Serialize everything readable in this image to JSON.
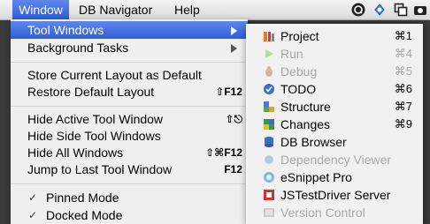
{
  "menubar": {
    "items": [
      {
        "label": "Window"
      },
      {
        "label": "DB Navigator"
      },
      {
        "label": "Help"
      }
    ],
    "tray_icons": [
      "help-circle-icon",
      "sync-icon",
      "window-switch-icon",
      "camera-icon"
    ]
  },
  "window_menu": {
    "items": [
      {
        "label": "Tool Windows",
        "has_submenu": true
      },
      {
        "label": "Background Tasks",
        "has_submenu": true
      },
      {
        "label": "Store Current Layout as Default"
      },
      {
        "label": "Restore Default Layout",
        "shortcut": "⇧F12"
      },
      {
        "label": "Hide Active Tool Window",
        "shortcut": "⇧⎋"
      },
      {
        "label": "Hide Side Tool Windows"
      },
      {
        "label": "Hide All Windows",
        "shortcut": "⇧⌘F12"
      },
      {
        "label": "Jump to Last Tool Window",
        "shortcut": "F12"
      },
      {
        "label": "Pinned Mode",
        "checked": true
      },
      {
        "label": "Docked Mode",
        "checked": true
      }
    ],
    "check_glyph": "✓"
  },
  "tool_windows_submenu": {
    "items": [
      {
        "label": "Project",
        "shortcut": "⌘1",
        "enabled": true,
        "icon": "project-icon"
      },
      {
        "label": "Run",
        "shortcut": "⌘4",
        "enabled": false,
        "icon": "run-icon"
      },
      {
        "label": "Debug",
        "shortcut": "⌘5",
        "enabled": false,
        "icon": "debug-icon"
      },
      {
        "label": "TODO",
        "shortcut": "⌘6",
        "enabled": true,
        "icon": "todo-icon"
      },
      {
        "label": "Structure",
        "shortcut": "⌘7",
        "enabled": true,
        "icon": "structure-icon"
      },
      {
        "label": "Changes",
        "shortcut": "⌘9",
        "enabled": true,
        "icon": "changes-icon"
      },
      {
        "label": "DB Browser",
        "enabled": true,
        "icon": "db-browser-icon"
      },
      {
        "label": "Dependency Viewer",
        "enabled": false,
        "icon": "dependency-icon"
      },
      {
        "label": "eSnippet Pro",
        "enabled": true,
        "icon": "esnippet-icon"
      },
      {
        "label": "JSTestDriver Server",
        "enabled": true,
        "icon": "jstestdriver-icon"
      },
      {
        "label": "Version Control",
        "enabled": false,
        "icon": "version-control-icon"
      }
    ]
  }
}
